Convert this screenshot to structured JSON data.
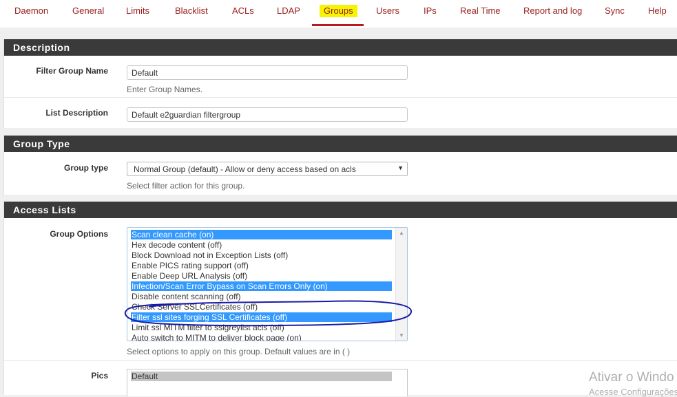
{
  "tabs": [
    {
      "label": "Daemon"
    },
    {
      "label": "General"
    },
    {
      "label": "Limits"
    },
    {
      "label": "Blacklist"
    },
    {
      "label": "ACLs"
    },
    {
      "label": "LDAP"
    },
    {
      "label": "Groups",
      "active": true
    },
    {
      "label": "Users"
    },
    {
      "label": "IPs"
    },
    {
      "label": "Real Time"
    },
    {
      "label": "Report and log"
    },
    {
      "label": "Sync"
    },
    {
      "label": "Help"
    }
  ],
  "description": {
    "heading": "Description",
    "filter_group_name": {
      "label": "Filter Group Name",
      "value": "Default",
      "help": "Enter Group Names."
    },
    "list_description": {
      "label": "List Description",
      "value": "Default e2guardian filtergroup"
    }
  },
  "group_type": {
    "heading": "Group Type",
    "label": "Group type",
    "selected": "Normal Group (default) - Allow or deny access based on acls",
    "help": "Select filter action for this group."
  },
  "access_lists": {
    "heading": "Access Lists",
    "group_options": {
      "label": "Group Options",
      "options": [
        {
          "text": "Scan clean cache (on)",
          "selected": true
        },
        {
          "text": "Hex decode content (off)",
          "selected": false
        },
        {
          "text": "Block Download not in Exception Lists (off)",
          "selected": false
        },
        {
          "text": "Enable PICS rating support (off)",
          "selected": false
        },
        {
          "text": "Enable Deep URL Analysis (off)",
          "selected": false
        },
        {
          "text": "Infection/Scan Error Bypass on Scan Errors Only (on)",
          "selected": true
        },
        {
          "text": "Disable content scanning (off)",
          "selected": false
        },
        {
          "text": "Check Server SSLCertificates (off)",
          "selected": false
        },
        {
          "text": "Filter ssl sites forging SSL Certificates (off)",
          "selected": true
        },
        {
          "text": "Limit ssl MITM filter to sslgreylist acls (off)",
          "selected": false
        },
        {
          "text": "Auto switch to MITM to deliver block page (on)",
          "selected": false
        }
      ],
      "help": "Select options to apply on this group. Default values are in ( )"
    },
    "pics": {
      "label": "Pics",
      "options": [
        {
          "text": "Default"
        }
      ]
    }
  },
  "watermark": {
    "line1": "Ativar o Windo",
    "line2": "Acesse Configurações"
  },
  "colors": {
    "accent": "#9a1c1c",
    "highlight": "#f6f400",
    "selection": "#3399ff",
    "annotation": "#1a1aa8"
  }
}
